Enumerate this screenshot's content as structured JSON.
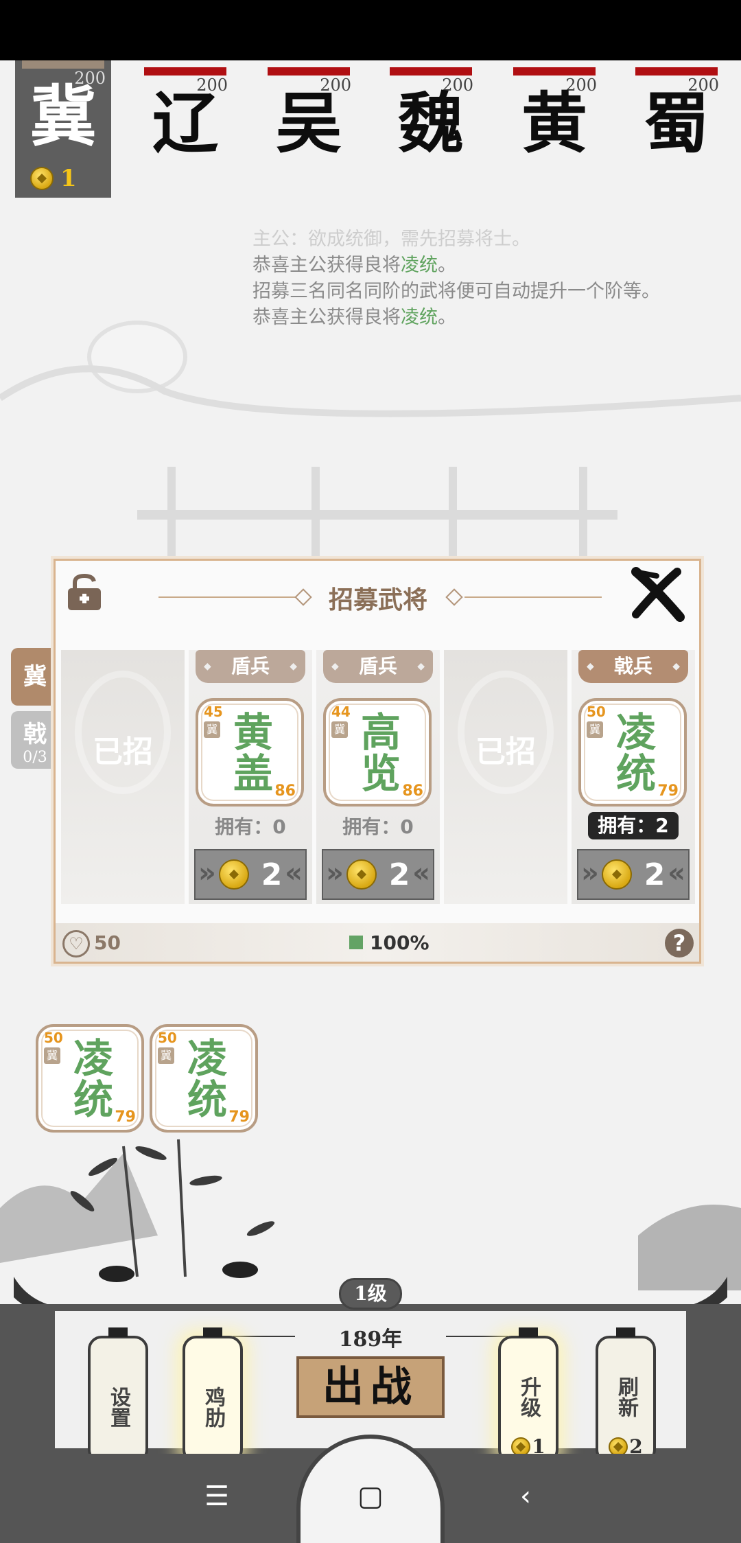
{
  "factions": [
    {
      "name": "冀",
      "hp": "200",
      "coins": "1",
      "active": true
    },
    {
      "name": "辽",
      "hp": "200"
    },
    {
      "name": "吴",
      "hp": "200"
    },
    {
      "name": "魏",
      "hp": "200"
    },
    {
      "name": "黄",
      "hp": "200"
    },
    {
      "name": "蜀",
      "hp": "200"
    }
  ],
  "log": {
    "line0": "主公：欲成统御，需先招募将士。",
    "line1_prefix": "恭喜主公获得良将",
    "line1_name": "凌统",
    "line1_suffix": "。",
    "line2": "招募三名同名同阶的武将便可自动提升一个阶等。",
    "line3_prefix": "恭喜主公获得良将",
    "line3_name": "凌统",
    "line3_suffix": "。"
  },
  "side_tabs": {
    "tab1": "冀",
    "tab2": "戟",
    "tab2_sub": "0/3"
  },
  "recruit": {
    "title": "招募武将",
    "taken_label": "已招",
    "slots": [
      {
        "taken": true
      },
      {
        "type": "盾兵",
        "cost": "45",
        "faction": "冀",
        "name": "黄盖",
        "power": "86",
        "owned": "拥有：0",
        "price": "2"
      },
      {
        "type": "盾兵",
        "cost": "44",
        "faction": "冀",
        "name": "高览",
        "power": "86",
        "owned": "拥有：0",
        "price": "2"
      },
      {
        "taken": true
      },
      {
        "type": "戟兵",
        "cost": "50",
        "faction": "冀",
        "name": "凌统",
        "power": "79",
        "owned": "拥有：2",
        "price": "2"
      }
    ],
    "hearts": "50",
    "percent": "100%",
    "help": "?"
  },
  "bench": [
    {
      "cost": "50",
      "faction": "冀",
      "name": "凌统",
      "power": "79"
    },
    {
      "cost": "50",
      "faction": "冀",
      "name": "凌统",
      "power": "79"
    }
  ],
  "gate": {
    "level": "1级",
    "year": "189年",
    "settings": "设置",
    "chicken": "鸡肋",
    "battle": "出战",
    "upgrade": "升级",
    "upgrade_cost": "1",
    "refresh": "刷新",
    "refresh_cost": "2"
  },
  "nav": {
    "menu_icon": "☰",
    "home_icon": "▢",
    "back_icon": "‹"
  },
  "colors": {
    "hp_red": "#b00f12",
    "general_green": "#5fa35e",
    "cost_orange": "#e6951e",
    "frame_tan": "#d9b48f"
  }
}
